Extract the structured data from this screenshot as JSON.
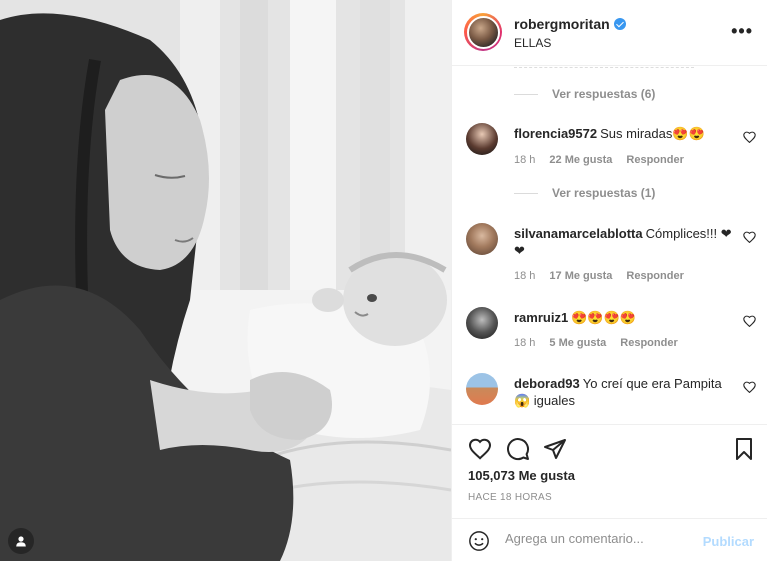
{
  "post": {
    "username": "robergmoritan",
    "verified": true,
    "caption_header": "ELLAS",
    "more_icon": "more-horizontal-icon"
  },
  "comments": [
    {
      "type": "replies",
      "label": "Ver respuestas (6)"
    },
    {
      "type": "comment",
      "username": "florencia9572",
      "text": "Sus miradas😍😍",
      "time": "18 h",
      "likes": "22 Me gusta",
      "reply": "Responder"
    },
    {
      "type": "replies",
      "label": "Ver respuestas (1)"
    },
    {
      "type": "comment",
      "username": "silvanamarcelablotta",
      "text": "Cómplices!!! ❤❤",
      "time": "18 h",
      "likes": "17 Me gusta",
      "reply": "Responder"
    },
    {
      "type": "comment",
      "username": "ramruiz1",
      "text": "😍😍😍😍",
      "time": "18 h",
      "likes": "5 Me gusta",
      "reply": "Responder"
    },
    {
      "type": "comment",
      "username": "deborad93",
      "text": "Yo creí que era Pampita 😱 iguales"
    }
  ],
  "stats": {
    "likes": "105,073 Me gusta",
    "time_ago": "HACE 18 HORAS"
  },
  "composer": {
    "placeholder": "Agrega un comentario...",
    "publish_label": "Publicar"
  },
  "colors": {
    "accent": "#3897f0",
    "publish_disabled": "#b3dbff",
    "meta": "#8e8e8e",
    "text": "#262626"
  }
}
